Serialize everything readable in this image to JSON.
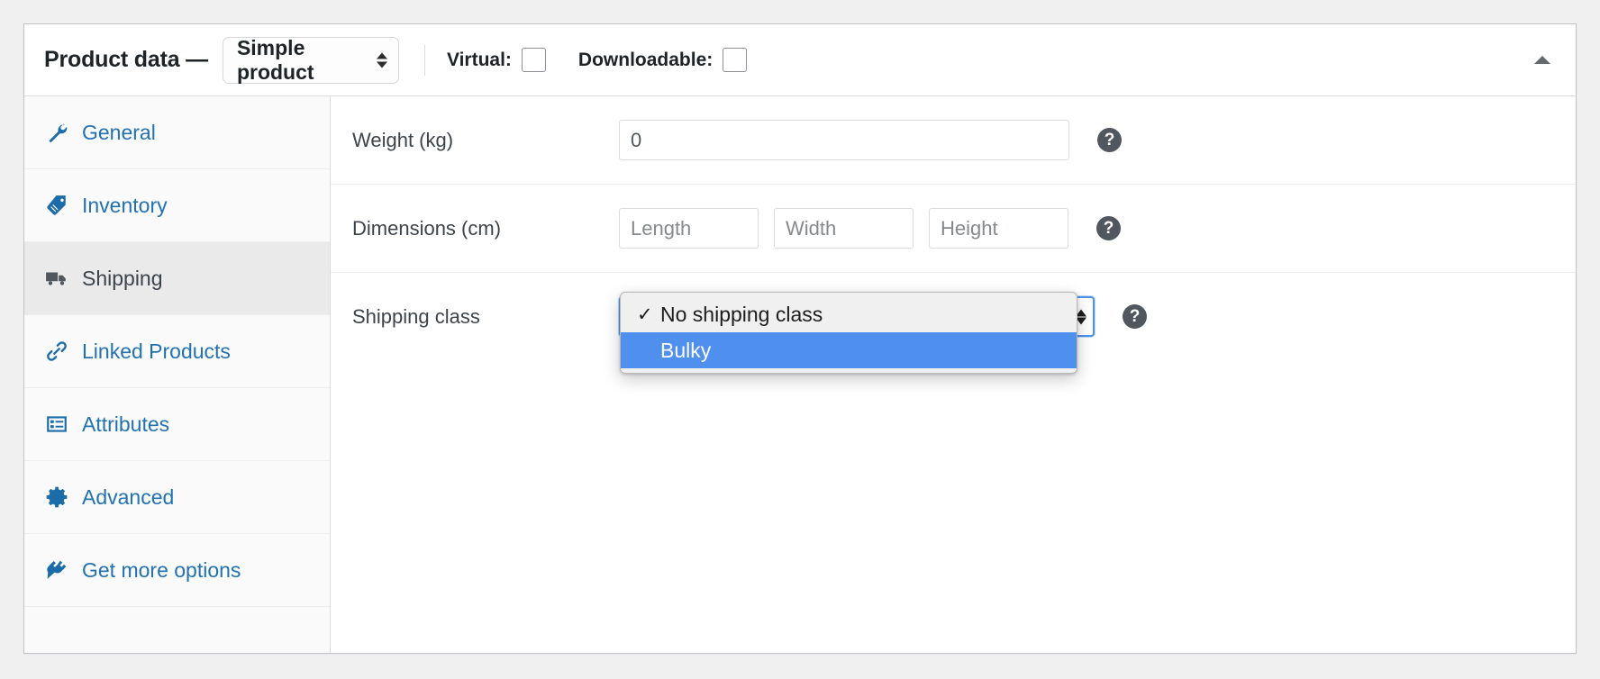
{
  "panel": {
    "title": "Product data —",
    "product_type": {
      "selected": "Simple product",
      "icon": "stepper-arrows-icon"
    },
    "checkboxes": [
      {
        "label": "Virtual:",
        "checked": false,
        "name": "virtual"
      },
      {
        "label": "Downloadable:",
        "checked": false,
        "name": "downloadable"
      }
    ],
    "collapse_toggle_icon": "chevron-up-icon"
  },
  "tabs": [
    {
      "id": "general",
      "label": "General",
      "icon": "wrench-icon",
      "active": false
    },
    {
      "id": "inventory",
      "label": "Inventory",
      "icon": "tag-icon",
      "active": false
    },
    {
      "id": "shipping",
      "label": "Shipping",
      "icon": "truck-icon",
      "active": true
    },
    {
      "id": "linked-products",
      "label": "Linked Products",
      "icon": "link-icon",
      "active": false
    },
    {
      "id": "attributes",
      "label": "Attributes",
      "icon": "list-card-icon",
      "active": false
    },
    {
      "id": "advanced",
      "label": "Advanced",
      "icon": "gear-icon",
      "active": false
    },
    {
      "id": "get-more-options",
      "label": "Get more options",
      "icon": "plugin-icon",
      "active": false
    }
  ],
  "shipping_panel": {
    "weight": {
      "label": "Weight (kg)",
      "value": "0",
      "placeholder": "0",
      "help_icon": "question-mark-icon"
    },
    "dimensions": {
      "label": "Dimensions (cm)",
      "length_placeholder": "Length",
      "length_value": "",
      "width_placeholder": "Width",
      "width_value": "",
      "height_placeholder": "Height",
      "height_value": "",
      "help_icon": "question-mark-icon"
    },
    "shipping_class": {
      "label": "Shipping class",
      "selected": "No shipping class",
      "highlighted": "Bulky",
      "open": true,
      "options": [
        {
          "label": "No shipping class",
          "checked": true,
          "highlighted": false
        },
        {
          "label": "Bulky",
          "checked": false,
          "highlighted": true
        }
      ],
      "help_icon": "question-mark-icon",
      "check_glyph": "✓"
    }
  },
  "colors": {
    "link": "#2271b1",
    "active_tab_bg": "#eaeaea",
    "highlight_blue": "#4f90ef",
    "focus_blue": "#4f94e8",
    "help_gray": "#50575e",
    "page_bg": "#f0f0f1"
  }
}
